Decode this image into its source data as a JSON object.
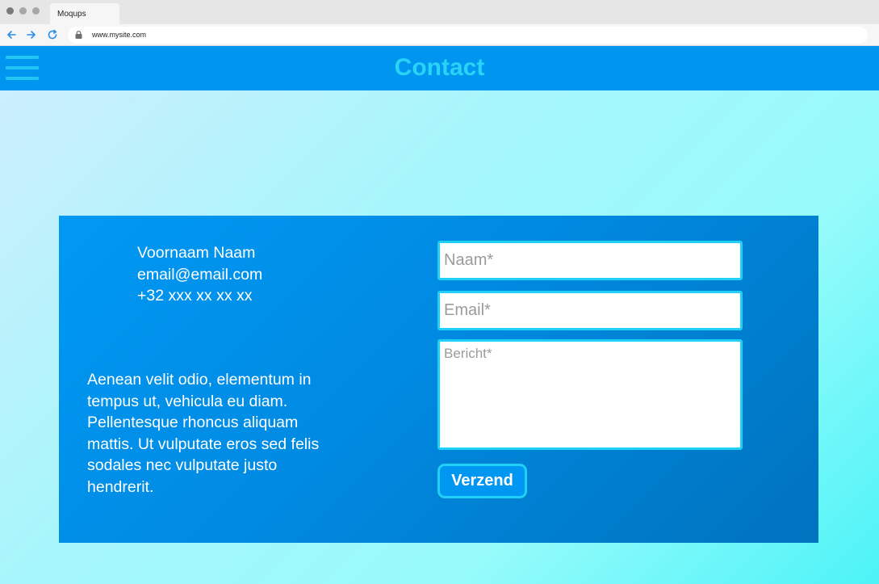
{
  "browser": {
    "tab_title": "Moqups",
    "url": "www.mysite.com"
  },
  "header": {
    "title": "Contact"
  },
  "contact": {
    "name": "Voornaam Naam",
    "email": "email@email.com",
    "phone": "+32 xxx xx xx xx"
  },
  "blurb": "Aenean velit odio, elementum in tempus ut, vehicula eu diam. Pellentesque rhoncus aliquam mattis. Ut vulputate eros sed felis sodales nec vulputate justo hendrerit.",
  "form": {
    "name_placeholder": "Naam*",
    "email_placeholder": "Email*",
    "message_placeholder": "Bericht*",
    "submit_label": "Verzend"
  },
  "colors": {
    "header_bg": "#0096f0",
    "accent": "#21d0f6",
    "card_bg": "#0088e0"
  }
}
